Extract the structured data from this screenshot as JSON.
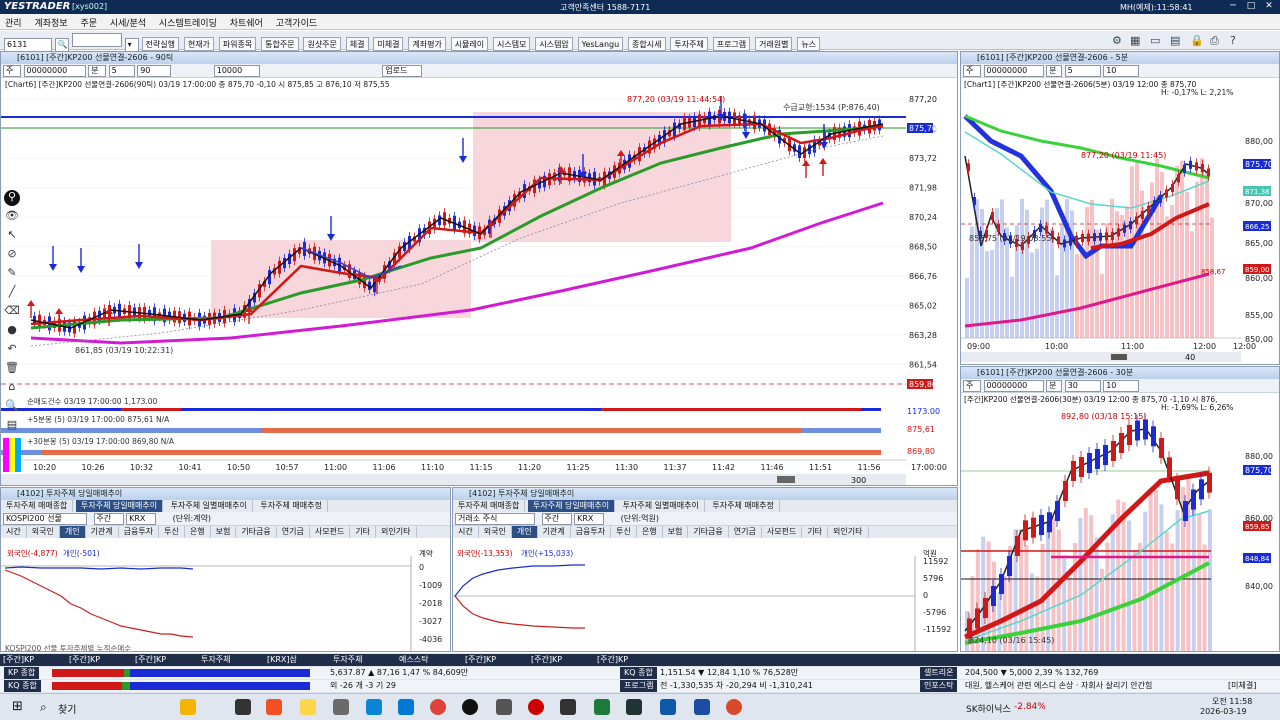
{
  "titlebar": {
    "logo": "YESTRADER",
    "account": "[xys002]",
    "center": "고객만족센터 1588-7171",
    "clock": "MH(예제):11:58:41",
    "controls": [
      "─",
      "□",
      "✕"
    ]
  },
  "menu": [
    "관리",
    "계좌정보",
    "주문",
    "시세/분석",
    "시스템트레이딩",
    "차트쉐어",
    "고객가이드"
  ],
  "toolbar": {
    "code": "6131",
    "buttons": [
      "전략실행",
      "현재가",
      "파워종목",
      "통합주문",
      "원샷주문",
      "체결",
      "미체결",
      "계좌평가",
      "시뮬레이",
      "시스템모",
      "시스템압",
      "YesLangu",
      "종합시세",
      "투자주체",
      "프로그램",
      "거래원별",
      "뉴스"
    ]
  },
  "main_chart": {
    "title": "[6101] [주간]KP200 선물연결-2606 - 90틱",
    "code": "00000000",
    "period": "5",
    "count": "90",
    "count2": "10000",
    "extra_btn": "업로드",
    "info": "[Chart6]  [주간]KP200 선물연결-2606(90틱)  03/19 17:00:00  종 875,70 -0,10  시 875,85  고 876,10  저 875,55",
    "price_labels": [
      "877,20",
      "875,70",
      "873,72",
      "871,98",
      "870,24",
      "868,50",
      "866,76",
      "865,02",
      "863,28",
      "861,54"
    ],
    "current_price": "875,70",
    "low_marker": "859,80",
    "annotations": {
      "high": "877,20 (03/19 11:44:54)",
      "low": "861,85 (03/19 10:22:31)",
      "supply": "수급교형:1534 (P:876,40)"
    },
    "time_labels": [
      "10:20",
      "10:26",
      "10:32",
      "10:41",
      "10:50",
      "10:57",
      "11:00",
      "11:06",
      "11:10",
      "11:15",
      "11:20",
      "11:25",
      "11:30",
      "11:37",
      "11:42",
      "11:46",
      "11:51",
      "11:56"
    ],
    "time_last": "17:00:00",
    "scroll_value": "300",
    "sub1": "순매도건수  03/19 17:00:00  1,173.00",
    "sub1_value": "1173.00",
    "sub2": "+5분봉  (5)  03/19 17:00:00  875,61  N/A",
    "sub2_value": "875,61",
    "sub3": "+30분봉  (5)  03/19 17:00:00  869,80  N/A",
    "sub3_value": "869,80"
  },
  "chart_5m": {
    "title": "[6101] [주간]KP200 선물연결-2606 - 5분",
    "code": "00000000",
    "period": "5",
    "count": "10",
    "info": "[Chart1]  [주간]KP200 선물연결-2606(5분)  03/19 12:00  종 875,70",
    "hl": "H: -0,17%   L: 2,21%",
    "price_labels": [
      "880,00",
      "875,70",
      "870,00",
      "865,00",
      "860,00",
      "855,00",
      "850,00"
    ],
    "side_labels": [
      "15,00",
      "871,38",
      "866,25",
      "859,00",
      "858,67"
    ],
    "annotation_high": "877,20 (03/19 11:45)",
    "annotation_low": "856,75 (03/19 08:55)",
    "time_labels": [
      "09:00",
      "10:00",
      "11:00",
      "12:00",
      "12:00"
    ],
    "zoom": "40"
  },
  "chart_30m": {
    "title": "[6101] [주간]KP200 선물연결-2606 - 30분",
    "code": "00000000",
    "period": "30",
    "count": "10",
    "info": "[주간]KP200 선물연결-2606(30분) 03/19 12:00  종 875,70 -1,10  시 876,",
    "hl": "H: -1,69%   L: 6,26%",
    "price_labels": [
      "880,00",
      "875,70",
      "860,00",
      "840,00"
    ],
    "side_labels": [
      "859,85",
      "848,84"
    ],
    "annotation_high": "892,80 (03/18 15:15)",
    "annotation_low": "824,10 (03/16 15:45)"
  },
  "panel_left": {
    "title": "[4102] 투자주체 당일매매추이",
    "tabs": [
      "투자주체 매매종합",
      "투자주체 당일매매추이",
      "투자주체 일별매매추이",
      "투자주체 매매추정"
    ],
    "market": "KOSPI200 선물",
    "unit_sel": "주간",
    "krx": "KRX",
    "unit": "(단위:계약)",
    "categories": [
      "시간",
      "외국인",
      "개인",
      "기관계",
      "금융투자",
      "투신",
      "은행",
      "보험",
      "기타금융",
      "연기금",
      "사모펀드",
      "기타",
      "외인기타"
    ],
    "legend": "외국인(-4,877) 개인(-501)",
    "foreign": "외국인(-4,877)",
    "retail": "개인(-501)",
    "y_title": "계약",
    "y_labels": [
      "0",
      "-1009",
      "-2018",
      "-3027",
      "-4036"
    ],
    "footer": "KOSPI200 선물 투자주체별 누적순매수"
  },
  "panel_right": {
    "title": "[4102] 투자주체 당일매매추이",
    "tabs": [
      "투자주체 매매종합",
      "투자주체 당일매매추이",
      "투자주체 일별매매추이",
      "투자주체 매매추정"
    ],
    "market": "거래소 주식",
    "unit_sel": "주간",
    "krx": "KRX",
    "unit": "(단위:억원)",
    "categories": [
      "시간",
      "외국인",
      "개인",
      "기관계",
      "금융투자",
      "투신",
      "은행",
      "보험",
      "기타금융",
      "연기금",
      "사모펀드",
      "기타",
      "외인기타"
    ],
    "legend": "외국인(-13,353) 개인(+15,033)",
    "foreign": "외국인(-13,353)",
    "retail": "개인(+15,033)",
    "y_title": "억원",
    "y_labels": [
      "11592",
      "5796",
      "0",
      "-5796",
      "-11592"
    ]
  },
  "status": {
    "tabs": [
      "[주간]KP",
      "[주간]KP",
      "[주간]KP",
      "투자주체",
      "[KRX]삼",
      "투자주체",
      "예스스탁",
      "[주간]KP",
      "[주간]KP",
      "[주간]KP"
    ],
    "row1_left": "KP 종합",
    "row1_vals": "5,637.87  ▲ 87,16  1,47 %  84,609만",
    "row1_right": "KQ 종합",
    "row1_right_vals": "1,151.54  ▼ 12,84  1,10 %  76,528만",
    "row1_tag": "셀트리온",
    "row1_tag_vals": "204,500  ▼ 5,000  2,39 %  132,769",
    "row2_left": "KQ 종합",
    "row2_vals": "외 -26  개 -3  기 29",
    "row2_mid": "프로그램",
    "row2_mid_vals": "전 -1,330,535  차 -20,294  비 -1,310,241",
    "row2_tag": "인포스탁",
    "row2_tag_vals": "대원, 헬스케어 관련 에스디 손상 · 자회사 살리기 안간힘",
    "row2_extra": "[미체결]"
  },
  "taskbar": {
    "search": "찾기",
    "stock": "SK하이닉스",
    "stock_change": "-2.84%",
    "time": "오전 11:58",
    "date": "2026-03-19"
  },
  "colors": {
    "up": "#d01818",
    "down": "#1a2ad6",
    "ma_green": "#2a9a28",
    "ma_magenta": "#d21ad6",
    "title_bg": "#0e2b55",
    "box_fill": "#f7d6dc"
  }
}
